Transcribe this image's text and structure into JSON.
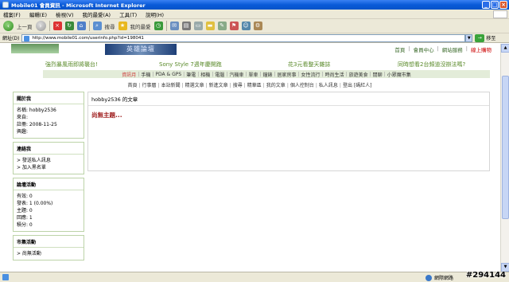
{
  "window": {
    "title": "Mobile01 會員資訊 - Microsoft Internet Explorer"
  },
  "menubar": [
    "檔案(F)",
    "編輯(E)",
    "檢視(V)",
    "我的最愛(A)",
    "工具(T)",
    "說明(H)"
  ],
  "toolbar": {
    "back": "上一頁",
    "search": "搜尋",
    "favorites": "我的最愛"
  },
  "address": {
    "label": "網址(D)",
    "url": "http://www.mobile01.com/userinfo.php?id=198041",
    "go": "移至"
  },
  "site": {
    "banner": "英雄論壇",
    "toplinks": [
      "首頁",
      "會員中心",
      "網站服務",
      "線上購物"
    ],
    "ads": [
      "強烈暴風雨即將襲台!",
      "Sony Style 7週年慶開跑",
      "花3元看整天雜誌",
      "同時想看2台頻道沒辦法嗎?"
    ],
    "categories": [
      "資訊月",
      "手機",
      "PDA & GPS",
      "筆電",
      "相機",
      "電腦",
      "汽機車",
      "單車",
      "鐘錶",
      "居家房事",
      "女性流行",
      "時尚生活",
      "旅遊美食",
      "閒聊",
      "小眾魔市集"
    ],
    "subnav": [
      "首頁",
      "行事曆",
      "本站新聞",
      "精選文章",
      "新進文章",
      "搜尋",
      "精華區",
      "我的文章",
      "個人控制台",
      "私人訊息",
      "登出 [碼紅人]"
    ]
  },
  "sidebar": {
    "profile": {
      "title": "關於我",
      "lines": [
        "名稱: hobby2536",
        "來自:",
        "註冊: 2008-11-25",
        "興趣:"
      ]
    },
    "contact": {
      "title": "連絡我",
      "lines": [
        "> 發送私人訊息",
        "> 加入黑名單"
      ]
    },
    "stats": {
      "title": "論壇活動",
      "lines": [
        "有效: 0",
        "發表: 1 (0.00%)",
        "主題: 0",
        "回應: 1",
        "積分: 0"
      ]
    },
    "market": {
      "title": "市集活動",
      "lines": [
        "> 尚無活動"
      ]
    }
  },
  "main": {
    "header": "hobby2536 的文章",
    "message": "尚無主題..."
  },
  "status": {
    "zone": "網際網路"
  },
  "watermark": "#294144"
}
